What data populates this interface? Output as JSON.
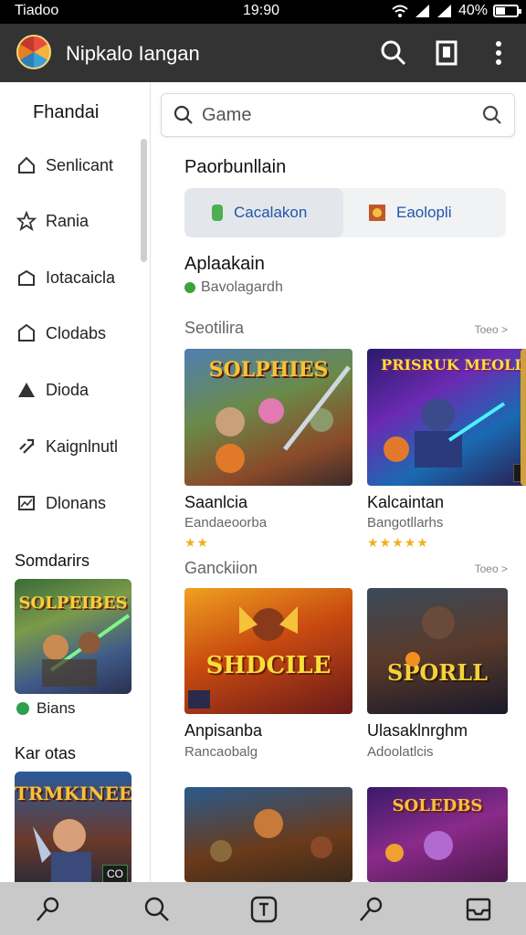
{
  "status_bar": {
    "carrier": "Tiadoo",
    "time": "19:90",
    "battery": "40%",
    "battery_level": 0.4
  },
  "app_bar": {
    "title": "Nipkalo Iangan",
    "icons": [
      "search-icon",
      "bookmark-icon",
      "more-vert-icon"
    ]
  },
  "sidebar": {
    "heading": "Fhandai",
    "items": [
      {
        "label": "Senlicant",
        "icon": "home-icon"
      },
      {
        "label": "Rania",
        "icon": "star-icon"
      },
      {
        "label": "Iotacaicla",
        "icon": "store-icon"
      },
      {
        "label": "Clodabs",
        "icon": "tag-icon"
      },
      {
        "label": "Dioda",
        "icon": "warning-icon"
      },
      {
        "label": "Kaignlnutl",
        "icon": "link-icon"
      },
      {
        "label": "Dlonans",
        "icon": "image-icon"
      }
    ],
    "sections": [
      {
        "title": "Somdarirs",
        "card_title": "SOLPEIBES",
        "meta": "Bians"
      },
      {
        "title": "Kar otas",
        "card_title": "TRMKINEES",
        "badge": "CO"
      }
    ]
  },
  "main": {
    "search_placeholder": "Game",
    "heading": "Paorbunllain",
    "segments": [
      {
        "label": "Cacalakon",
        "active": true
      },
      {
        "label": "Eaolopli",
        "active": false
      }
    ],
    "subheading": "Aplaakain",
    "subline": "Bavolagardh",
    "rows": [
      {
        "title": "Seotilira",
        "more": "Toeo >",
        "tiles": [
          {
            "art": "SOLPHIES",
            "name": "Saanlcia",
            "dev": "Eandaeoorba",
            "stars": "★★"
          },
          {
            "art": "PRISRUK MEOLI",
            "name": "Kalcaintan",
            "dev": "Bangotllarhs",
            "stars": "★★★★★"
          }
        ]
      },
      {
        "title": "Ganckiion",
        "more": "Toeo >",
        "tiles": [
          {
            "art": "SHDCILE",
            "name": "Anpisanba",
            "dev": "Rancaobalg"
          },
          {
            "art": "SPORLL",
            "name": "Ulasaklnrghm",
            "dev": "Adoolatlcis"
          }
        ]
      },
      {
        "tiles": [
          {
            "art": ""
          },
          {
            "art": "SOLEDBS"
          }
        ]
      }
    ]
  },
  "bottom_nav": [
    "pin-icon",
    "search-icon",
    "tile-icon",
    "pencil-icon",
    "inbox-icon"
  ]
}
